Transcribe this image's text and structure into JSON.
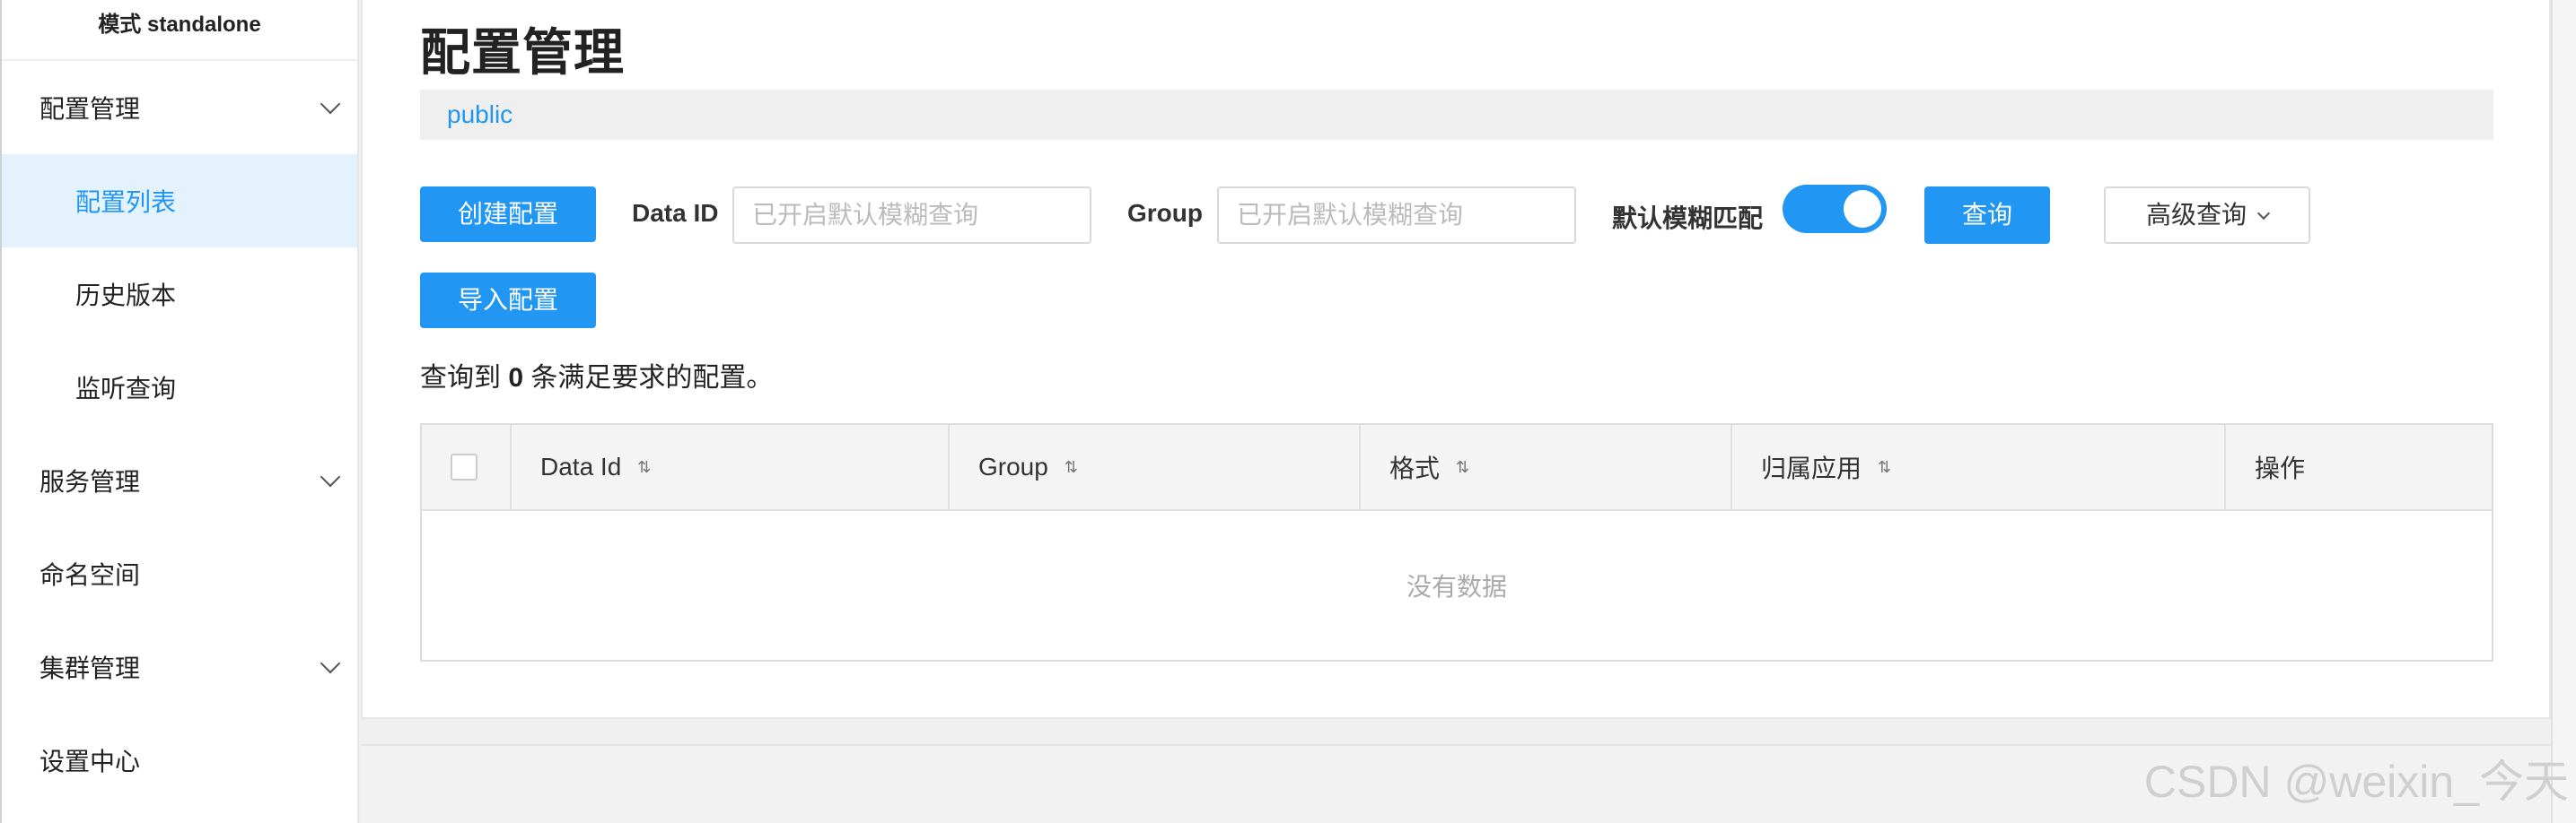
{
  "sidebar": {
    "mode": "模式 standalone",
    "items": [
      {
        "label": "配置管理"
      },
      {
        "label": "配置列表"
      },
      {
        "label": "历史版本"
      },
      {
        "label": "监听查询"
      },
      {
        "label": "服务管理"
      },
      {
        "label": "命名空间"
      },
      {
        "label": "集群管理"
      },
      {
        "label": "设置中心"
      }
    ]
  },
  "main": {
    "title": "配置管理",
    "namespace": "public",
    "create_button": "创建配置",
    "import_button": "导入配置",
    "data_id_label": "Data ID",
    "data_id_placeholder": "已开启默认模糊查询",
    "group_label": "Group",
    "group_placeholder": "已开启默认模糊查询",
    "fuzzy_label": "默认模糊匹配",
    "fuzzy_enabled": true,
    "query_button": "查询",
    "advanced_button": "高级查询",
    "result_prefix": "查询到 ",
    "result_count": "0",
    "result_suffix": " 条满足要求的配置。"
  },
  "table": {
    "columns": [
      {
        "label": "Data Id"
      },
      {
        "label": "Group"
      },
      {
        "label": "格式"
      },
      {
        "label": "归属应用"
      },
      {
        "label": "操作"
      }
    ],
    "empty_text": "没有数据"
  },
  "watermark": "CSDN @weixin_今天",
  "colors": {
    "accent": "#2196f3",
    "active_bg": "#e3f2fd"
  }
}
